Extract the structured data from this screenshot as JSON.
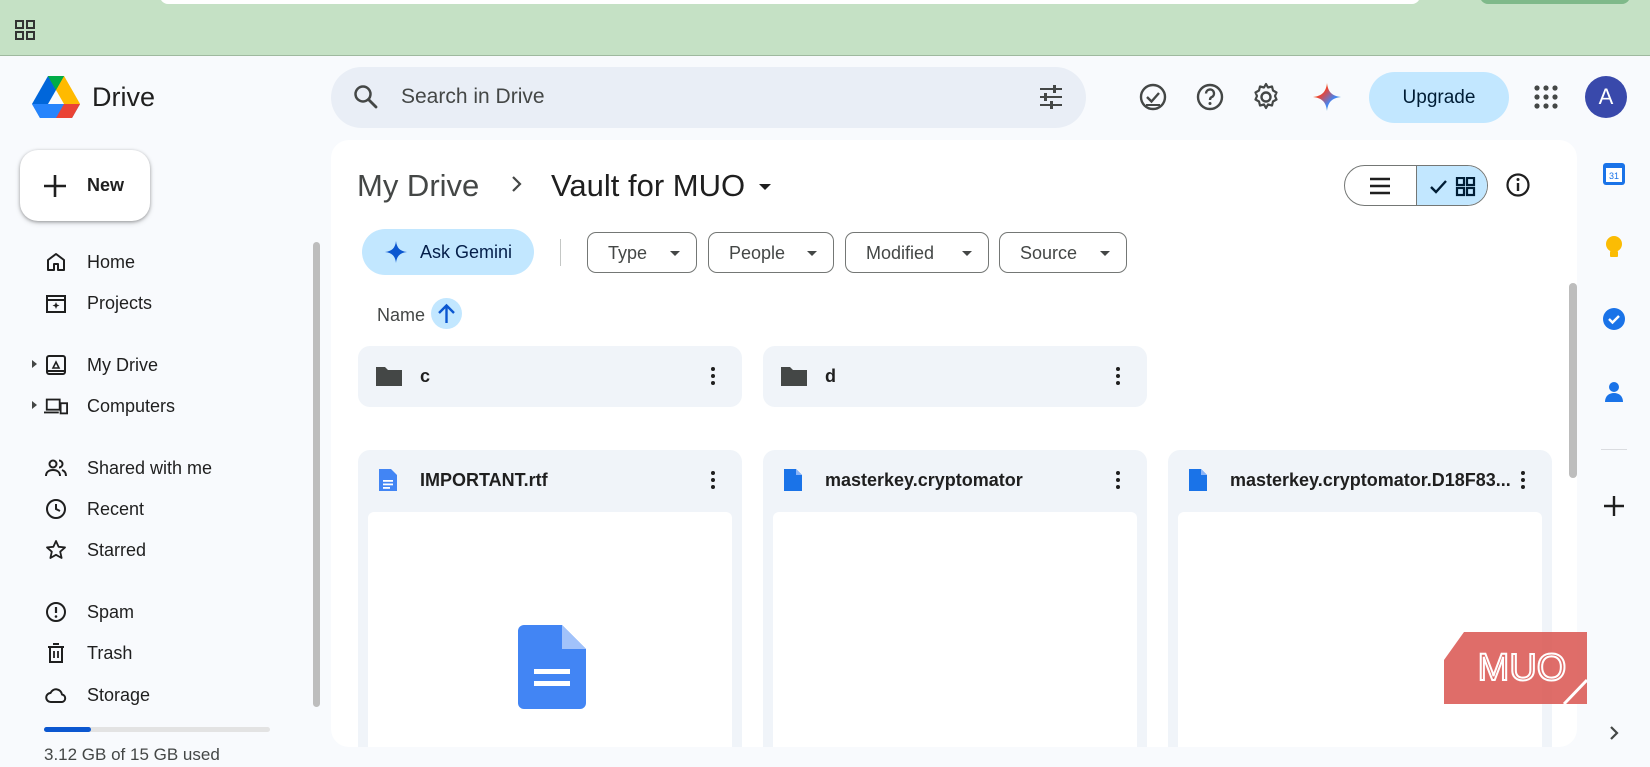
{
  "app": {
    "brand": "Drive"
  },
  "search": {
    "placeholder": "Search in Drive"
  },
  "header": {
    "upgrade_label": "Upgrade",
    "avatar_letter": "A"
  },
  "sidebar": {
    "new_label": "New",
    "items": [
      {
        "label": "Home",
        "icon": "home-icon"
      },
      {
        "label": "Projects",
        "icon": "projects-icon"
      },
      {
        "label": "My Drive",
        "icon": "my-drive-icon"
      },
      {
        "label": "Computers",
        "icon": "computers-icon"
      },
      {
        "label": "Shared with me",
        "icon": "shared-icon"
      },
      {
        "label": "Recent",
        "icon": "clock-icon"
      },
      {
        "label": "Starred",
        "icon": "star-icon"
      },
      {
        "label": "Spam",
        "icon": "spam-icon"
      },
      {
        "label": "Trash",
        "icon": "trash-icon"
      },
      {
        "label": "Storage",
        "icon": "cloud-icon"
      }
    ],
    "storage_text": "3.12 GB of 15 GB used",
    "storage_fraction": 0.208
  },
  "breadcrumb": {
    "parent": "My Drive",
    "current": "Vault for MUO"
  },
  "filters": {
    "ask_gemini": "Ask Gemini",
    "chips": [
      "Type",
      "People",
      "Modified",
      "Source"
    ]
  },
  "sort": {
    "label": "Name",
    "direction": "ascending"
  },
  "folders": [
    {
      "name": "c"
    },
    {
      "name": "d"
    }
  ],
  "files": [
    {
      "name": "IMPORTANT.rtf"
    },
    {
      "name": "masterkey.cryptomator"
    },
    {
      "name": "masterkey.cryptomator.D18F83..."
    }
  ],
  "rail": {
    "calendar_day": "31"
  },
  "watermark": "MUO",
  "colors": {
    "browser_bar": "#c5e1c5",
    "accent_blue": "#0b57d0",
    "chip_selected": "#c2e7ff",
    "doc_blue": "#4285f4"
  }
}
